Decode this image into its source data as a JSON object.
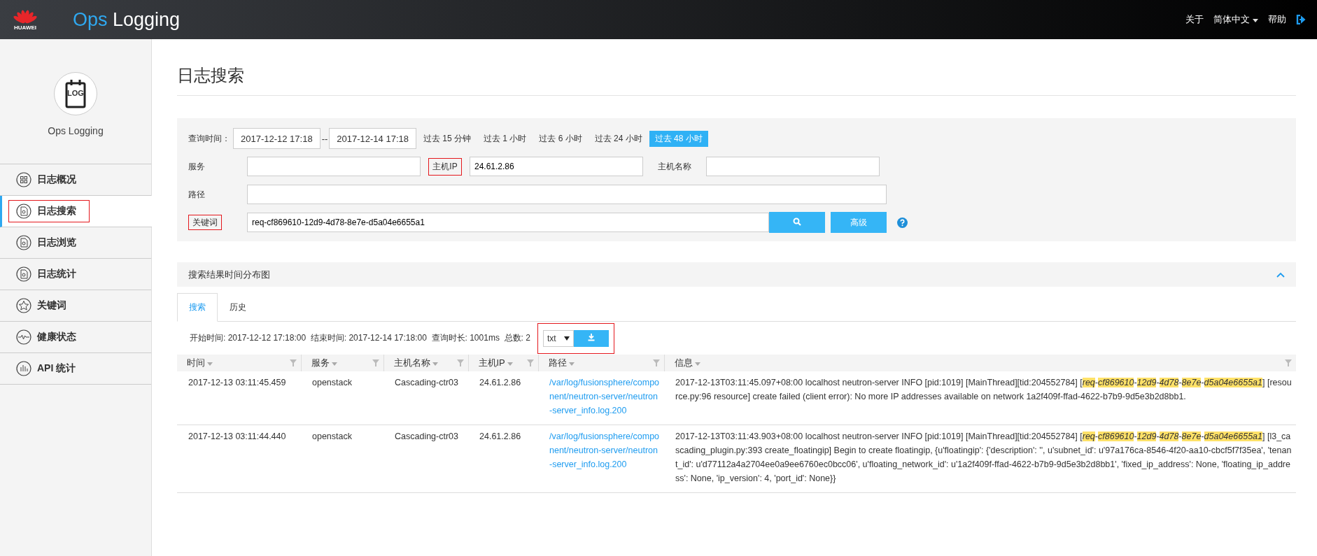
{
  "header": {
    "logo_text": "HUAWEI",
    "title_part1": "Ops",
    "title_part2": "Logging",
    "links": [
      {
        "label": "关于",
        "kind": "link"
      },
      {
        "label": "简体中文",
        "kind": "dropdown"
      },
      {
        "label": "帮助",
        "kind": "link"
      },
      {
        "kind": "logout"
      }
    ]
  },
  "sidebar": {
    "app_name": "Ops Logging",
    "avatar_text": "LOG",
    "items": [
      {
        "label": "日志概况",
        "selected": false,
        "annotated": false
      },
      {
        "label": "日志搜索",
        "selected": true,
        "annotated": true
      },
      {
        "label": "日志浏览",
        "selected": false,
        "annotated": false
      },
      {
        "label": "日志统计",
        "selected": false,
        "annotated": false
      },
      {
        "label": "关键词",
        "selected": false,
        "annotated": false
      },
      {
        "label": "健康状态",
        "selected": false,
        "annotated": false
      },
      {
        "label": "API 统计",
        "selected": false,
        "annotated": false
      }
    ]
  },
  "page_title": "日志搜索",
  "form": {
    "time_label": "查询时间：",
    "start": "2017-12-12 17:18",
    "separator": "--",
    "end": "2017-12-14 17:18",
    "ranges": [
      {
        "label": "过去 15 分钟",
        "selected": false
      },
      {
        "label": "过去 1 小时",
        "selected": false
      },
      {
        "label": "过去 6 小时",
        "selected": false
      },
      {
        "label": "过去 24 小时",
        "selected": false
      },
      {
        "label": "过去 48 小时",
        "selected": true
      }
    ],
    "service_label": "服务",
    "host_ip_label": "主机IP",
    "host_ip_annotated": true,
    "host_ip_value": "24.61.2.86",
    "host_name_label": "主机名称",
    "path_label": "路径",
    "keyword_label": "关键词",
    "keyword_annotated": true,
    "keyword_value": "req-cf869610-12d9-4d78-8e7e-d5a04e6655a1",
    "advanced_button": "高级"
  },
  "chart_section": {
    "title": "搜索结果时间分布图",
    "expanded": true
  },
  "tabs": [
    {
      "label": "搜索",
      "selected": true
    },
    {
      "label": "历史",
      "selected": false
    }
  ],
  "summary": {
    "text": "开始时间: 2017-12-12 17:18:00  结束时间: 2017-12-14 17:18:00  查询时长: 1001ms  总数: 2",
    "format": "txt",
    "annotated": true
  },
  "table": {
    "columns": [
      "时间",
      "服务",
      "主机名称",
      "主机IP",
      "路径",
      "信息"
    ],
    "rows": [
      {
        "time": "2017-12-13 03:11:45.459",
        "service": "openstack",
        "host": "Cascading-ctr03",
        "ip": "24.61.2.86",
        "path": "/var/log/fusionsphere/component/neutron-server/neutron-server_info.log.200",
        "message": "2017-12-13T03:11:45.097+08:00 localhost neutron-server INFO [pid:1019] [MainThread][tid:204552784] [*req*-*cf869610*-*12d9*-*4d78*-*8e7e*-*d5a04e6655a1*] [resource.py:96 resource] create failed (client error): No more IP addresses available on network 1a2f409f-ffad-4622-b7b9-9d5e3b2d8bb1."
      },
      {
        "time": "2017-12-13 03:11:44.440",
        "service": "openstack",
        "host": "Cascading-ctr03",
        "ip": "24.61.2.86",
        "path": "/var/log/fusionsphere/component/neutron-server/neutron-server_info.log.200",
        "message": "2017-12-13T03:11:43.903+08:00 localhost neutron-server INFO [pid:1019] [MainThread][tid:204552784] [*req*-*cf869610*-*12d9*-*4d78*-*8e7e*-*d5a04e6655a1*] [l3_cascading_plugin.py:393 create_floatingip] Begin to create floatingip, {u'floatingip': {'description': '', u'subnet_id': u'97a176ca-8546-4f20-aa10-cbcf5f7f35ea', 'tenant_id': u'd77112a4a2704ee0a9ee6760ec0bcc06', u'floating_network_id': u'1a2f409f-ffad-4622-b7b9-9d5e3b2d8bb1', 'fixed_ip_address': None, 'floating_ip_address': None, 'ip_version': 4, 'port_id': None}}"
      }
    ]
  }
}
